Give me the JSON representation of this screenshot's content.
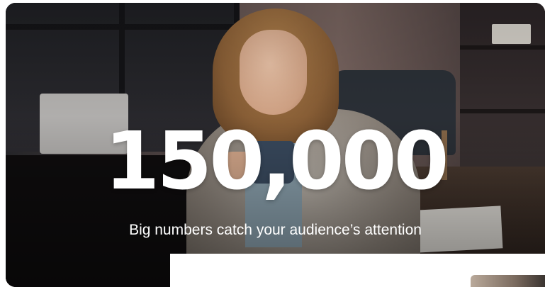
{
  "slide": {
    "statistic": "150,000",
    "caption": "Big numbers catch your audience’s attention",
    "background_image": "woman-with-mug-office-photo",
    "text_color": "#ffffff"
  },
  "next_slide_preview": {
    "background_color": "#ffffff"
  }
}
